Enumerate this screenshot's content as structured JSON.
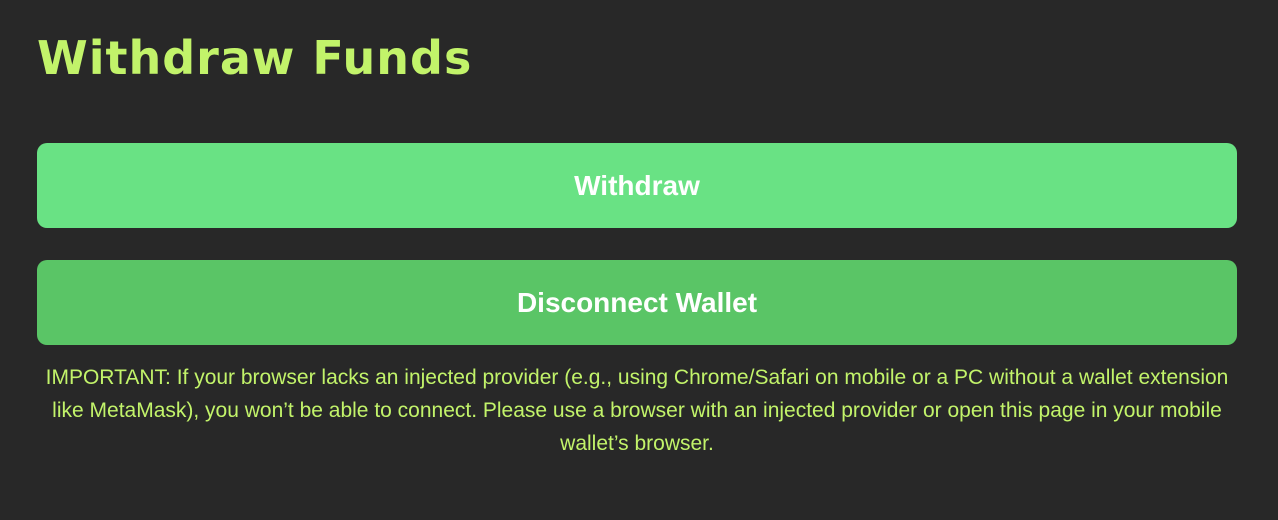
{
  "page": {
    "title": "Withdraw Funds"
  },
  "actions": {
    "withdraw_label": "Withdraw",
    "disconnect_label": "Disconnect Wallet"
  },
  "notice": {
    "text": "IMPORTANT: If your browser lacks an injected provider (e.g., using Chrome/Safari on mobile or a PC without a wallet extension like MetaMask), you won’t be able to connect. Please use a browser with an injected provider or open this page in your mobile wallet’s browser."
  },
  "colors": {
    "background": "#282828",
    "accent_text": "#c2f36a",
    "withdraw_button": "#69e284",
    "disconnect_button": "#5ac566",
    "button_text": "#ffffff"
  }
}
